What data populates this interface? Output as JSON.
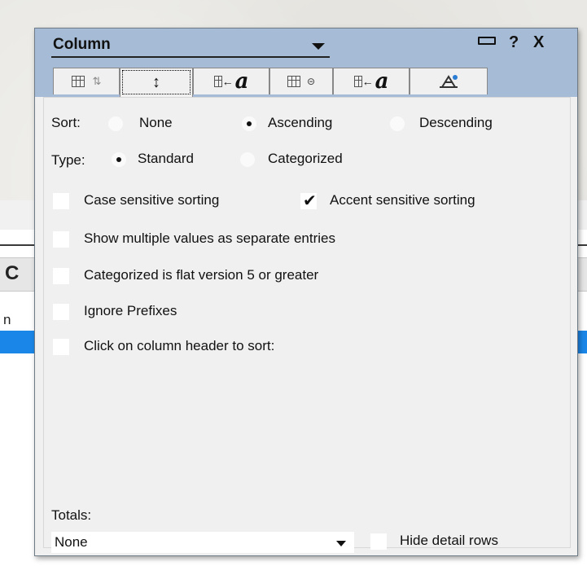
{
  "background": {
    "header_text": "C",
    "row_text": "n",
    "selection_color": "#1a86e8"
  },
  "dialog": {
    "title": "Column",
    "help_label": "?",
    "close_label": "X",
    "tabs": [
      {
        "name": "tab-column-info",
        "icon": "grid-icon"
      },
      {
        "name": "tab-sorting",
        "icon": "up-down-icon",
        "label": "↕"
      },
      {
        "name": "tab-column-font",
        "icon": "column-font-icon",
        "label": "←",
        "glyph": "a"
      },
      {
        "name": "tab-numbers",
        "icon": "grid-number-icon"
      },
      {
        "name": "tab-header-font",
        "icon": "header-font-icon",
        "label": "←",
        "glyph": "a"
      },
      {
        "name": "tab-advanced",
        "icon": "hat-icon"
      }
    ],
    "sort": {
      "label": "Sort:",
      "options": [
        "None",
        "Ascending",
        "Descending"
      ],
      "selected": "Ascending"
    },
    "type": {
      "label": "Type:",
      "options": [
        "Standard",
        "Categorized"
      ],
      "selected": "Standard"
    },
    "checkboxes": {
      "case_sensitive": {
        "label": "Case sensitive sorting",
        "checked": false
      },
      "accent_sensitive": {
        "label": "Accent sensitive sorting",
        "checked": true
      },
      "multiple_values": {
        "label": "Show multiple values as separate entries",
        "checked": false
      },
      "categorized_flat": {
        "label": "Categorized is flat version 5 or greater",
        "checked": false
      },
      "ignore_prefixes": {
        "label": "Ignore Prefixes",
        "checked": false
      },
      "click_header": {
        "label": "Click on column header to sort:",
        "checked": false
      },
      "hide_detail": {
        "label": "Hide detail rows",
        "checked": false
      }
    },
    "totals": {
      "label": "Totals:",
      "value": "None"
    }
  }
}
